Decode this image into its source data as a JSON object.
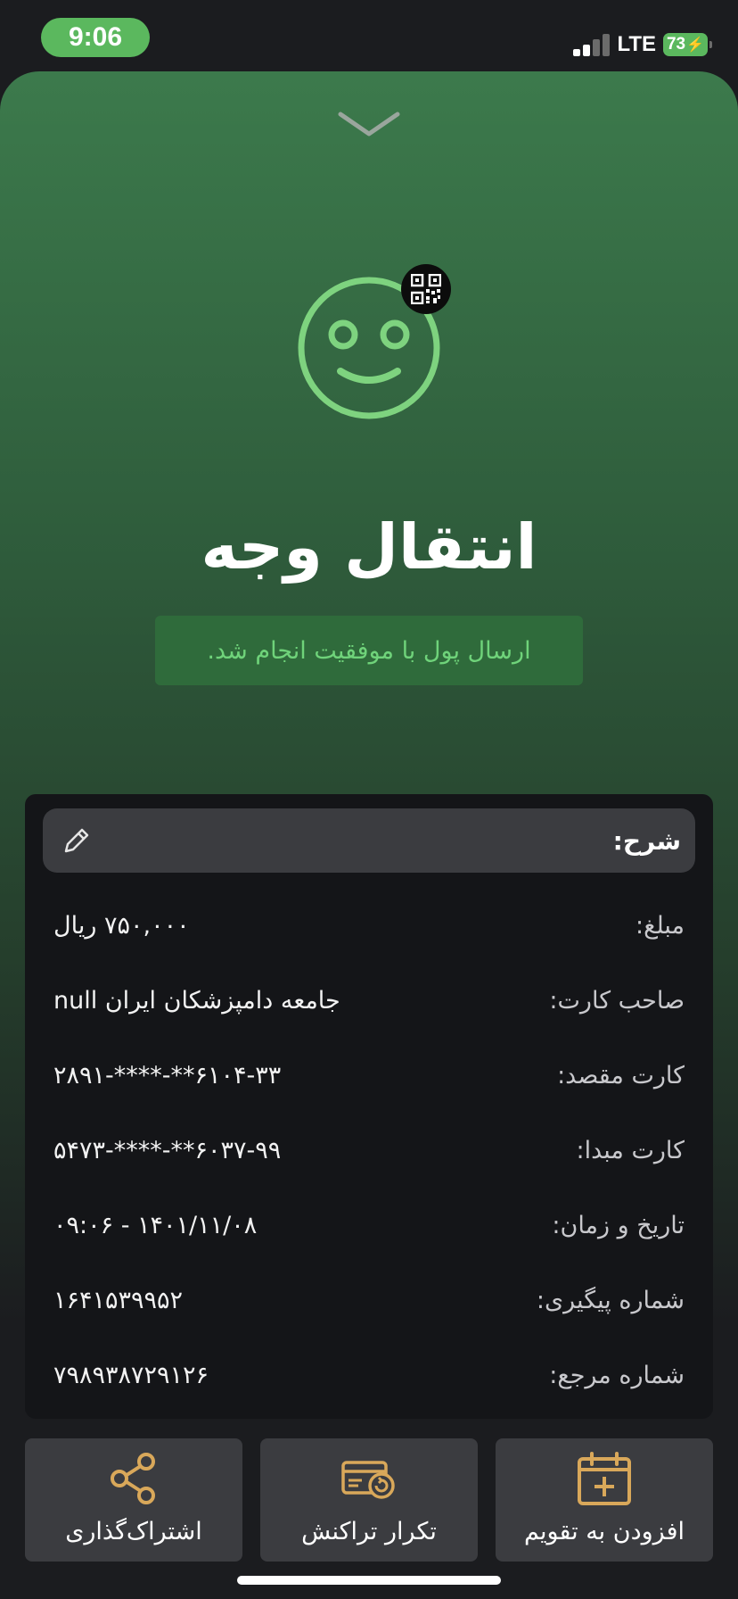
{
  "status_bar": {
    "time": "9:06",
    "network": "LTE",
    "battery": "73"
  },
  "receipt": {
    "title": "انتقال وجه",
    "status_message": "ارسال پول با موفقیت انجام شد.",
    "description_label": "شرح:",
    "details": [
      {
        "label": "مبلغ:",
        "value": "۷۵۰,۰۰۰ ریال"
      },
      {
        "label": "صاحب کارت:",
        "value": "جامعه دامپزشکان ایران null"
      },
      {
        "label": "کارت مقصد:",
        "value": "۶۱۰۴-۳۳**-****-۲۸۹۱"
      },
      {
        "label": "کارت مبدا:",
        "value": "۶۰۳۷-۹۹**-****-۵۴۷۳"
      },
      {
        "label": "تاریخ و زمان:",
        "value": "۱۴۰۱/۱۱/۰۸ - ۰۹:۰۶"
      },
      {
        "label": "شماره پیگیری:",
        "value": "۱۶۴۱۵۳۹۹۵۲"
      },
      {
        "label": "شماره مرجع:",
        "value": "۷۹۸۹۳۸۷۲۹۱۲۶"
      }
    ]
  },
  "actions": {
    "share": {
      "label": "اشتراک‌گذاری",
      "icon": "share-icon"
    },
    "repeat": {
      "label": "تکرار تراکنش",
      "icon": "repeat-transaction-icon"
    },
    "calendar": {
      "label": "افزودن به تقویم",
      "icon": "calendar-add-icon"
    }
  },
  "colors": {
    "accent_green": "#6fd37a",
    "success_bg": "#2f6b3b",
    "icon_gold": "#d9a85a",
    "card_bg": "#141518",
    "button_bg": "#3b3c40"
  }
}
